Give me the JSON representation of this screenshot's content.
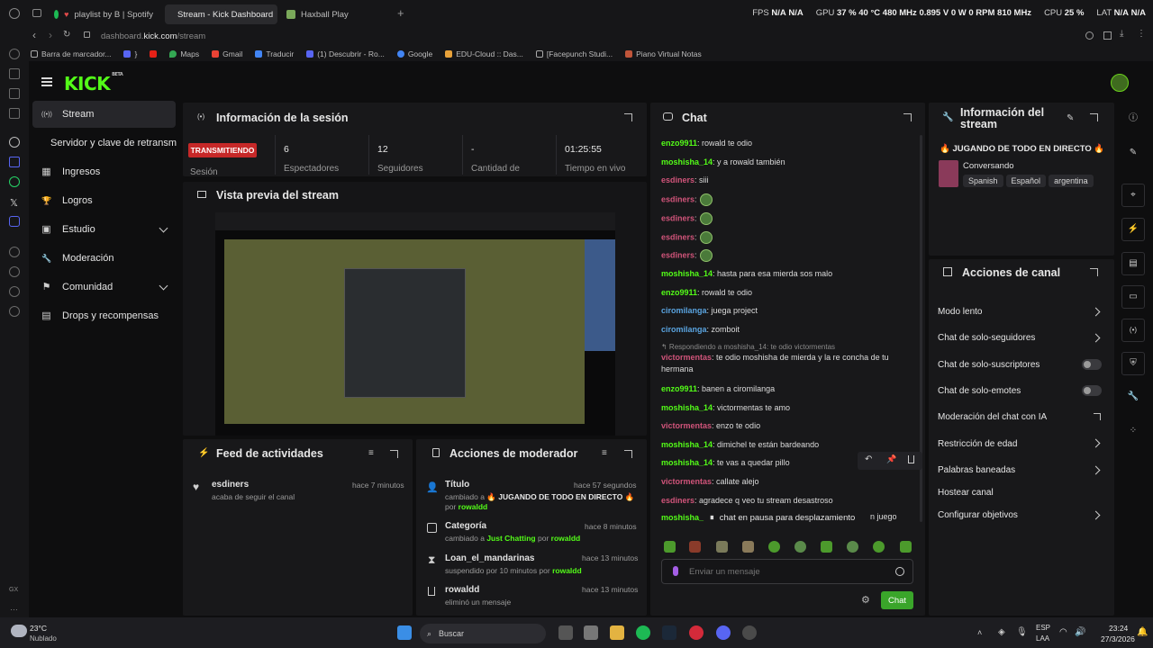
{
  "browser": {
    "tabs": [
      {
        "label": "playlist by B | Spotify",
        "active": false
      },
      {
        "label": "Stream - Kick Dashboard",
        "active": true
      },
      {
        "label": "Haxball Play",
        "active": false
      }
    ],
    "url_host": "dashboard.",
    "url_bold": "kick.com",
    "url_path": "/stream",
    "bookmarks": [
      "Barra de marcador...",
      "}",
      "Maps",
      "Gmail",
      "Traducir",
      "(1) Descubrir - Ro...",
      "Google",
      "EDU-Cloud :: Das...",
      "[Facepunch Studi...",
      "Piano Virtual Notas"
    ],
    "stats": {
      "fps_label": "FPS",
      "fps_1": "N/A",
      "fps_2": "N/A",
      "gpu_label": "GPU",
      "gpu_pct": "37 %",
      "gpu_temp": "40 °C",
      "gpu_clock": "480 MHz",
      "gpu_volt": "0.895 V",
      "gpu_power": "0 W",
      "gpu_fan": "0 RPM",
      "gpu_mem": "810 MHz",
      "cpu_label": "CPU",
      "cpu_pct": "25 %",
      "lat_label": "LAT",
      "lat_1": "N/A",
      "lat_2": "N/A"
    }
  },
  "app": {
    "logo": "KICK",
    "logo_badge": "BETA",
    "nav": [
      {
        "label": "Stream",
        "icon": "broadcast-icon",
        "glyph": "((•))"
      },
      {
        "label": "Servidor y clave de retransm",
        "icon": "",
        "glyph": ""
      },
      {
        "label": "Ingresos",
        "icon": "revenue-icon",
        "glyph": "▦"
      },
      {
        "label": "Logros",
        "icon": "trophy-icon",
        "glyph": "🏆"
      },
      {
        "label": "Estudio",
        "icon": "studio-icon",
        "glyph": "▣"
      },
      {
        "label": "Moderación",
        "icon": "wrench-icon",
        "glyph": "🔧"
      },
      {
        "label": "Comunidad",
        "icon": "community-icon",
        "glyph": "⚑"
      },
      {
        "label": "Drops y recompensas",
        "icon": "drops-icon",
        "glyph": "▤"
      }
    ],
    "session": {
      "title": "Información de la sesión",
      "badge": "TRANSMITIENDO",
      "badge_sub": "Sesión",
      "stats": [
        {
          "value": "6",
          "label": "Espectadores"
        },
        {
          "value": "12",
          "label": "Seguidores"
        },
        {
          "value": "-",
          "label": "Cantidad de"
        },
        {
          "value": "01:25:55",
          "label": "Tiempo en vivo"
        }
      ]
    },
    "preview": {
      "title": "Vista previa del stream"
    },
    "activity": {
      "title": "Feed de actividades",
      "items": [
        {
          "user": "esdiners",
          "text": "acaba de seguir el canal",
          "time": "hace 7 minutos"
        }
      ]
    },
    "modactions": {
      "title": "Acciones de moderador",
      "items": [
        {
          "title": "Título",
          "time": "hace 57 segundos",
          "pre": "cambiado a ",
          "value": "🔥 JUGANDO DE TODO EN DIRECTO 🔥",
          "mid": " por ",
          "by": "rowaldd"
        },
        {
          "title": "Categoría",
          "time": "hace 8 minutos",
          "pre": "cambiado a ",
          "value": "Just Chatting",
          "mid": " por ",
          "by": "rowaldd"
        },
        {
          "title": "Loan_el_mandarinas",
          "time": "hace 13 minutos",
          "pre": "suspendido por 10 minutos por ",
          "value": "",
          "mid": "",
          "by": "rowaldd"
        },
        {
          "title": "rowaldd",
          "time": "hace 13 minutos",
          "pre": "eliminó un mensaje",
          "value": "",
          "mid": "",
          "by": ""
        }
      ]
    },
    "chat": {
      "title": "Chat",
      "messages": [
        {
          "user": "enzo9911",
          "color": "#53fc18",
          "text": ": rowald te odio"
        },
        {
          "user": "moshisha_14",
          "color": "#53fc18",
          "text": ": y a rowald también"
        },
        {
          "user": "esdiners",
          "color": "#d0547a",
          "text": ": siii"
        },
        {
          "user": "esdiners",
          "color": "#d0547a",
          "text": ":",
          "emote": true
        },
        {
          "user": "esdiners",
          "color": "#d0547a",
          "text": ":",
          "emote": true
        },
        {
          "user": "esdiners",
          "color": "#d0547a",
          "text": ":",
          "emote": true
        },
        {
          "user": "esdiners",
          "color": "#d0547a",
          "text": ":",
          "emote": true
        },
        {
          "user": "moshisha_14",
          "color": "#53fc18",
          "text": ": hasta para esa mierda sos malo"
        },
        {
          "user": "enzo9911",
          "color": "#53fc18",
          "text": ": rowald te odio"
        },
        {
          "user": "ciromilanga",
          "color": "#5aa4e0",
          "text": ": juega project"
        },
        {
          "user": "ciromilanga",
          "color": "#5aa4e0",
          "text": ": zomboit"
        }
      ],
      "reply_note": "↰ Respondiendo a moshisha_14: te odio victormentas",
      "reply_user": "victormentas",
      "reply_text": ": te odio moshisha de mierda y la re concha de tu hermana",
      "messages2": [
        {
          "user": "enzo9911",
          "color": "#53fc18",
          "text": ": banen a ciromilanga"
        },
        {
          "user": "moshisha_14",
          "color": "#53fc18",
          "text": ": victormentas te amo"
        },
        {
          "user": "victormentas",
          "color": "#d0547a",
          "text": ": enzo te odio"
        },
        {
          "user": "moshisha_14",
          "color": "#53fc18",
          "text": ": dimichel te están bardeando"
        },
        {
          "user": "moshisha_14",
          "color": "#53fc18",
          "text": ": te vas a quedar pillo"
        },
        {
          "user": "victormentas",
          "color": "#d0547a",
          "text": ": callate alejo"
        },
        {
          "user": "esdiners",
          "color": "#d0547a",
          "text": ": agradece q veo tu stream desastroso"
        }
      ],
      "last_user": "moshisha_",
      "last_tail": "n juego",
      "paused": "chat en pausa para desplazamiento",
      "input_placeholder": "Enviar un mensaje",
      "send_label": "Chat"
    },
    "stream_info": {
      "title": "Información del stream",
      "stream_title": "🔥 JUGANDO DE TODO EN DIRECTO 🔥",
      "category": "Conversando",
      "tags": [
        "Spanish",
        "Español",
        "argentina"
      ]
    },
    "channel_actions": {
      "title": "Acciones de canal",
      "items": [
        {
          "label": "Modo lento",
          "kind": "chevron"
        },
        {
          "label": "Chat de solo-seguidores",
          "kind": "chevron"
        },
        {
          "label": "Chat de solo-suscriptores",
          "kind": "toggle"
        },
        {
          "label": "Chat de solo-emotes",
          "kind": "toggle"
        },
        {
          "label": "Moderación del chat con IA",
          "kind": "external"
        },
        {
          "label": "Restricción de edad",
          "kind": "chevron"
        },
        {
          "label": "Palabras baneadas",
          "kind": "chevron"
        },
        {
          "label": "Hostear canal",
          "kind": "none"
        },
        {
          "label": "Configurar objetivos",
          "kind": "chevron"
        }
      ]
    }
  },
  "taskbar": {
    "weather_temp": "23°C",
    "weather_desc": "Nublado",
    "search": "Buscar",
    "lang1": "ESP",
    "lang2": "LAA",
    "time": "23:24",
    "date": "27/3/2026"
  },
  "colors": {
    "kick_green": "#53fc18",
    "live_red": "#c62828",
    "panel": "#18181a"
  }
}
